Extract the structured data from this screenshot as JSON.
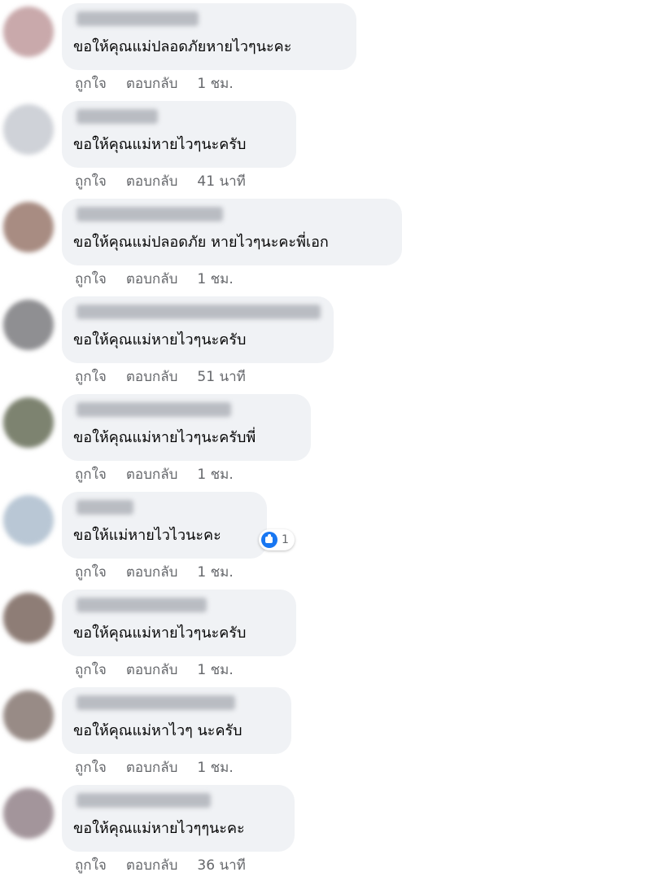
{
  "comments": [
    {
      "text": "ขอให้คุณแม่ปลอดภัยหายไวๆนะคะ",
      "like_label": "ถูกใจ",
      "reply_label": "ตอบกลับ",
      "time": "1 ชม.",
      "avatar_color": "#c9a9ab"
    },
    {
      "text": "ขอให้คุณแม่หายไวๆนะครับ",
      "like_label": "ถูกใจ",
      "reply_label": "ตอบกลับ",
      "time": "41 นาที",
      "avatar_color": "#cfd2d8"
    },
    {
      "text": "ขอให้คุณแม่ปลอดภัย หายไวๆนะคะพี่เอก",
      "like_label": "ถูกใจ",
      "reply_label": "ตอบกลับ",
      "time": "1 ชม.",
      "avatar_color": "#a88c82"
    },
    {
      "text": "ขอให้คุณแม่หายไวๆนะครับ",
      "like_label": "ถูกใจ",
      "reply_label": "ตอบกลับ",
      "time": "51 นาที",
      "avatar_color": "#8f8f92"
    },
    {
      "text": "ขอให้คุณแม่หายไวๆนะครับพี่",
      "like_label": "ถูกใจ",
      "reply_label": "ตอบกลับ",
      "time": "1 ชม.",
      "avatar_color": "#7d8370"
    },
    {
      "text": "ขอให้แม่หายไวไวนะคะ",
      "like_label": "ถูกใจ",
      "reply_label": "ตอบกลับ",
      "time": "1 ชม.",
      "avatar_color": "#b9c7d5",
      "reaction": {
        "icon": "like-icon",
        "count": "1",
        "color": "#1877f2"
      }
    },
    {
      "text": "ขอให้คุณแม่หายไวๆนะครับ",
      "like_label": "ถูกใจ",
      "reply_label": "ตอบกลับ",
      "time": "1 ชม.",
      "avatar_color": "#8e7d76"
    },
    {
      "text": "ขอให้คุณแม่หาไวๆ นะครับ",
      "like_label": "ถูกใจ",
      "reply_label": "ตอบกลับ",
      "time": "1 ชม.",
      "avatar_color": "#988b86"
    },
    {
      "text": "ขอให้คุณแม่หายไวๆๆนะคะ",
      "like_label": "ถูกใจ",
      "reply_label": "ตอบกลับ",
      "time": "36 นาที",
      "avatar_color": "#a3959b"
    }
  ]
}
